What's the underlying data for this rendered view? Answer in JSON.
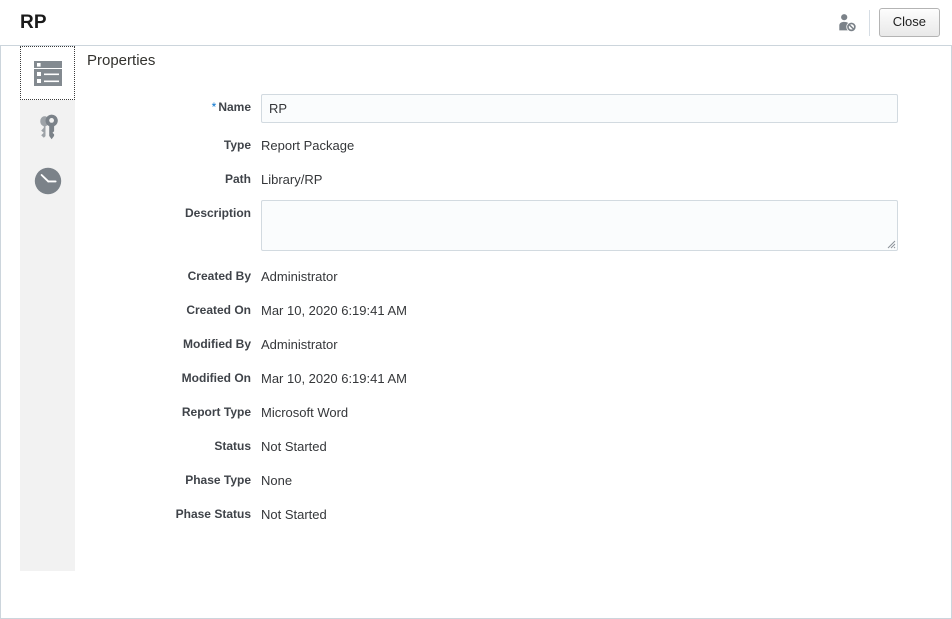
{
  "header": {
    "title": "RP",
    "user_icon": "user-unassigned-icon",
    "close_label": "Close"
  },
  "sidebar": {
    "items": [
      {
        "name": "properties",
        "icon": "properties-list-icon",
        "selected": true
      },
      {
        "name": "access",
        "icon": "keys-icon",
        "selected": false
      },
      {
        "name": "history",
        "icon": "clock-icon",
        "selected": false
      }
    ]
  },
  "main": {
    "heading": "Properties",
    "required_marker": "*",
    "fields": [
      {
        "label": "Name",
        "value": "RP",
        "type": "input",
        "required": true
      },
      {
        "label": "Type",
        "value": "Report Package",
        "type": "text"
      },
      {
        "label": "Path",
        "value": "Library/RP",
        "type": "text"
      },
      {
        "label": "Description",
        "value": "",
        "placeholder": "",
        "type": "textarea"
      },
      {
        "label": "Created By",
        "value": "Administrator",
        "type": "text"
      },
      {
        "label": "Created On",
        "value": "Mar 10, 2020 6:19:41 AM",
        "type": "text"
      },
      {
        "label": "Modified By",
        "value": "Administrator",
        "type": "text"
      },
      {
        "label": "Modified On",
        "value": "Mar 10, 2020 6:19:41 AM",
        "type": "text"
      },
      {
        "label": "Report Type",
        "value": "Microsoft Word",
        "type": "text"
      },
      {
        "label": "Status",
        "value": "Not Started",
        "type": "text"
      },
      {
        "label": "Phase Type",
        "value": "None",
        "type": "text"
      },
      {
        "label": "Phase Status",
        "value": "Not Started",
        "type": "text"
      }
    ]
  },
  "colors": {
    "required_asterisk": "#0572ce",
    "label_text": "#3f4349",
    "value_text": "#35373a",
    "sidebar_bg": "#f2f2f2",
    "panel_border": "#ccd5dc",
    "input_bg": "#fafcfd",
    "input_border": "#d2dae0",
    "icon_grey": "#7b8289"
  }
}
